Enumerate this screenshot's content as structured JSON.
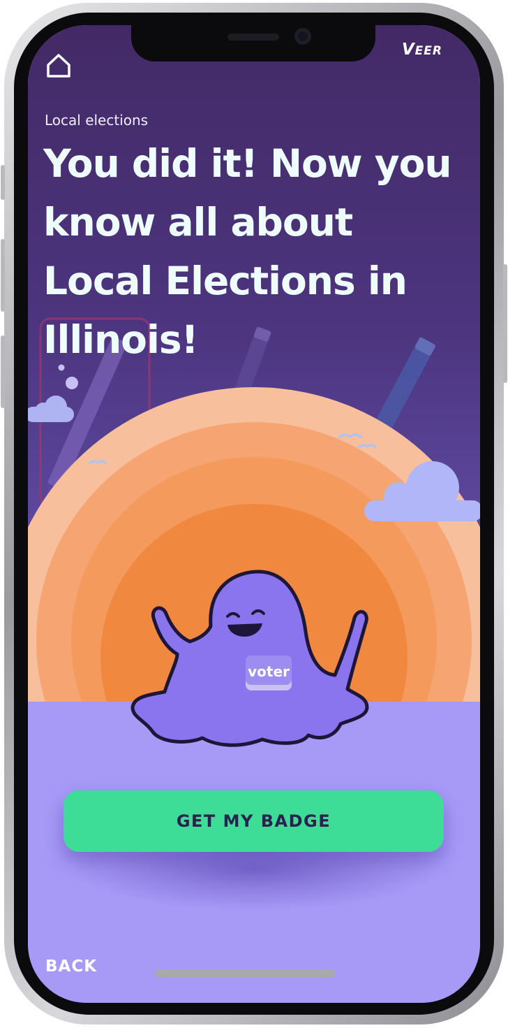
{
  "header": {
    "brand_big": "V",
    "brand_small": "EER"
  },
  "lesson": {
    "section": "Local elections",
    "headline": "You did it! Now you know all about Local Elections in Illinois!"
  },
  "illustration": {
    "badge_text": "voter"
  },
  "actions": {
    "cta_label": "GET MY BADGE",
    "back_label": "BACK"
  },
  "colors": {
    "sky_top": "#432a66",
    "sky_bottom": "#6a58b8",
    "ground": "#a79af7",
    "cta": "#3ddd97",
    "mascot": "#8a75ee"
  }
}
